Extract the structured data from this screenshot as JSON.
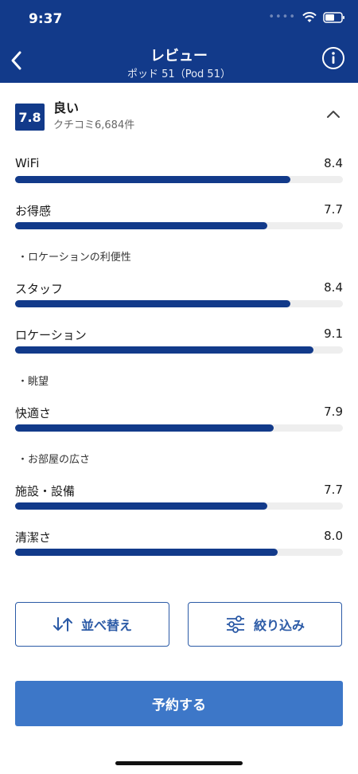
{
  "status": {
    "time": "9:37"
  },
  "header": {
    "title": "レビュー",
    "subtitle": "ポッド 51（Pod 51）"
  },
  "summary": {
    "score": "7.8",
    "rating": "良い",
    "count": "クチコミ6,684件"
  },
  "categories": [
    {
      "label": "WiFi",
      "score": "8.4",
      "value": 8.4
    },
    {
      "label": "お得感",
      "score": "7.7",
      "value": 7.7
    },
    {
      "label": "スタッフ",
      "score": "8.4",
      "value": 8.4
    },
    {
      "label": "ロケーション",
      "score": "9.1",
      "value": 9.1
    },
    {
      "label": "快適さ",
      "score": "7.9",
      "value": 7.9
    },
    {
      "label": "施設・設備",
      "score": "7.7",
      "value": 7.7
    },
    {
      "label": "清潔さ",
      "score": "8.0",
      "value": 8.0
    }
  ],
  "notes": [
    "・ロケーションの利便性",
    "・眺望",
    "・お部屋の広さ"
  ],
  "buttons": {
    "sort": "並べ替え",
    "filter": "絞り込み",
    "reserve": "予約する"
  },
  "colors": {
    "brand": "#123a8a",
    "accent": "#3d77c8"
  }
}
